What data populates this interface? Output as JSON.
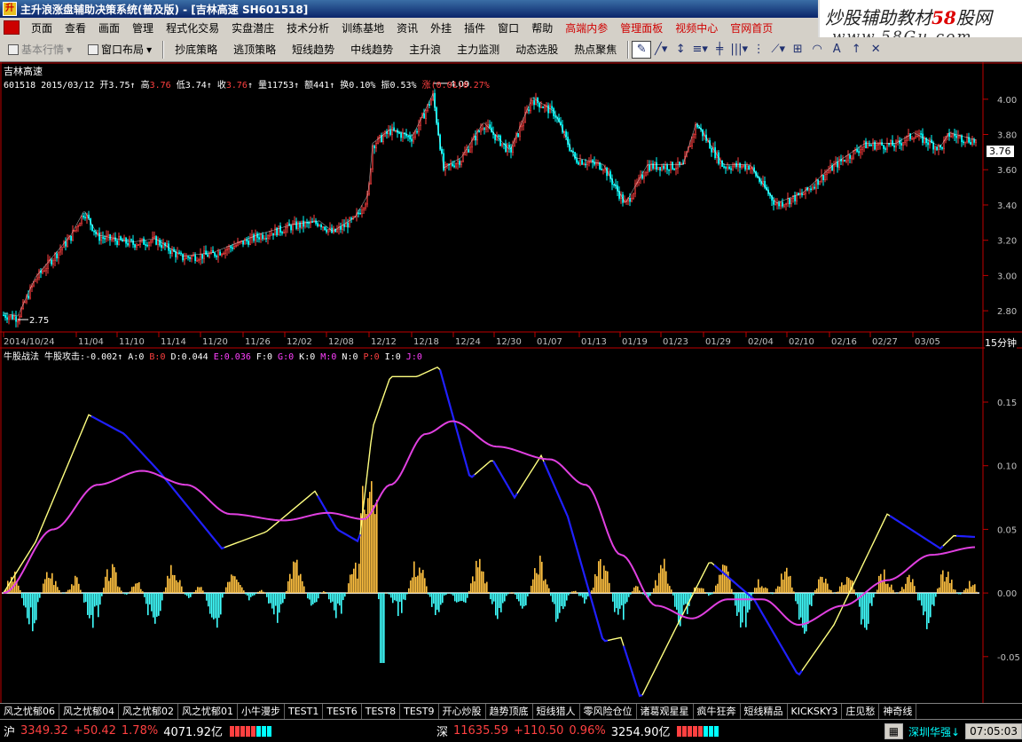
{
  "window": {
    "title": "主升浪涨盘辅助决策系统(普及版) - [吉林高速 SH601518]"
  },
  "watermark": {
    "line1_prefix": "炒股辅助教材",
    "line1_num": "58",
    "line1_suffix": "股网",
    "line2": "www.58Gu.com"
  },
  "menu": {
    "items": [
      "页面",
      "查看",
      "画面",
      "管理",
      "程式化交易",
      "实盘潜庄",
      "技术分析",
      "训练基地",
      "资讯",
      "外挂",
      "插件",
      "窗口",
      "帮助"
    ],
    "red_items": [
      "高端内参",
      "管理面板",
      "视频中心",
      "官网首页"
    ]
  },
  "toolbar": {
    "basic_quote": "基本行情",
    "window_layout": "窗口布局",
    "strategies": [
      "抄底策略",
      "逃顶策略",
      "短线趋势",
      "中线趋势",
      "主升浪",
      "主力监测",
      "动态选股",
      "热点聚焦"
    ]
  },
  "kline": {
    "stock_name": "吉林高速",
    "code": "601518",
    "date": "2015/03/12",
    "open_label": "开",
    "open": "3.75",
    "high_label": "高",
    "high": "3.76",
    "low_label": "低",
    "low": "3.74",
    "close_label": "收",
    "close": "3.76",
    "volume_label": "量",
    "volume": "11753",
    "amount_label": "额",
    "amount": "441",
    "turnover_label": "换",
    "turnover": "0.10%",
    "amplitude_label": "振",
    "amplitude": "0.53%",
    "change_label": "涨",
    "change": "(0.01)0.27%",
    "max_label": "4.09",
    "min_label": "2.75",
    "last_price": "3.76",
    "period": "15分钟",
    "price_ticks": [
      "4.00",
      "3.80",
      "3.60",
      "3.40",
      "3.20",
      "3.00",
      "2.80"
    ],
    "date_ticks": [
      "2014/10/24",
      "11/04",
      "11/10",
      "11/14",
      "11/20",
      "11/26",
      "12/02",
      "12/08",
      "12/12",
      "12/18",
      "12/24",
      "12/30",
      "01/07",
      "01/13",
      "01/19",
      "01/23",
      "01/29",
      "02/04",
      "02/10",
      "02/16",
      "02/27",
      "03/05"
    ]
  },
  "indicator": {
    "name": "牛股战法",
    "attack_label": "牛股攻击:",
    "attack": "-0.002",
    "params": [
      {
        "k": "A",
        "v": "0",
        "color": "#ffffff"
      },
      {
        "k": "B",
        "v": "0",
        "color": "#ff4040"
      },
      {
        "k": "D",
        "v": "0.044",
        "color": "#ffffff"
      },
      {
        "k": "E",
        "v": "0.036",
        "color": "#ff40ff"
      },
      {
        "k": "F",
        "v": "0",
        "color": "#ffffff"
      },
      {
        "k": "G",
        "v": "0",
        "color": "#ff40ff"
      },
      {
        "k": "K",
        "v": "0",
        "color": "#ffffff"
      },
      {
        "k": "M",
        "v": "0",
        "color": "#ff40ff"
      },
      {
        "k": "N",
        "v": "0",
        "color": "#ffffff"
      },
      {
        "k": "P",
        "v": "0",
        "color": "#ff4040"
      },
      {
        "k": "I",
        "v": "0",
        "color": "#ffffff"
      },
      {
        "k": "J",
        "v": "0",
        "color": "#ff40ff"
      }
    ],
    "ticks": [
      "0.15",
      "0.10",
      "0.05",
      "0.00",
      "-0.05"
    ]
  },
  "tabs": [
    "风之忧郁06",
    "风之忧郁04",
    "风之忧郁02",
    "风之忧郁01",
    "小牛漫步",
    "TEST1",
    "TEST6",
    "TEST8",
    "TEST9",
    "开心炒股",
    "趋势顶底",
    "短线猎人",
    "零风险仓位",
    "诸葛观星星",
    "疯牛狂奔",
    "短线精品",
    "KICKSKY3",
    "庄见愁",
    "神奇线"
  ],
  "status": {
    "sh_label": "沪",
    "sh_index": "3349.32",
    "sh_change": "+50.42",
    "sh_pct": "1.78%",
    "sh_amount": "4071.92亿",
    "sz_label": "深",
    "sz_index": "11635.59",
    "sz_change": "+110.50",
    "sz_pct": "0.96%",
    "sz_amount": "3254.90亿",
    "stock_tip": "深圳华强↓",
    "time": "07:05:03"
  },
  "colors": {
    "up": "#ff4040",
    "down": "#00ffff",
    "ma": "#ffff80",
    "indicator_yellow": "#ffff80",
    "indicator_blue": "#2020ff",
    "indicator_magenta": "#e040e0",
    "axis": "#c00000"
  }
}
